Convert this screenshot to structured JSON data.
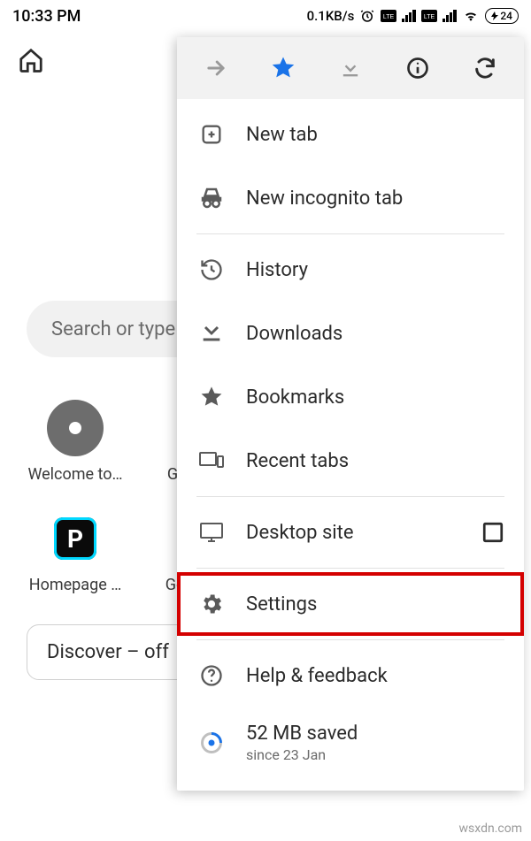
{
  "status": {
    "time": "10:33 PM",
    "net_speed": "0.1KB/s",
    "battery": "24"
  },
  "search": {
    "placeholder": "Search or type"
  },
  "tiles": {
    "row1": [
      {
        "label": "Welcome to…"
      },
      {
        "label": "Gr"
      }
    ],
    "row2": [
      {
        "label": "Homepage …"
      },
      {
        "label": "Go"
      }
    ]
  },
  "discover": {
    "label": "Discover – off"
  },
  "menu": {
    "new_tab": "New tab",
    "new_incognito": "New incognito tab",
    "history": "History",
    "downloads": "Downloads",
    "bookmarks": "Bookmarks",
    "recent_tabs": "Recent tabs",
    "desktop_site": "Desktop site",
    "settings": "Settings",
    "help": "Help & feedback",
    "data_saved_main": "52 MB saved",
    "data_saved_sub": "since 23 Jan"
  },
  "watermark": "wsxdn.com"
}
